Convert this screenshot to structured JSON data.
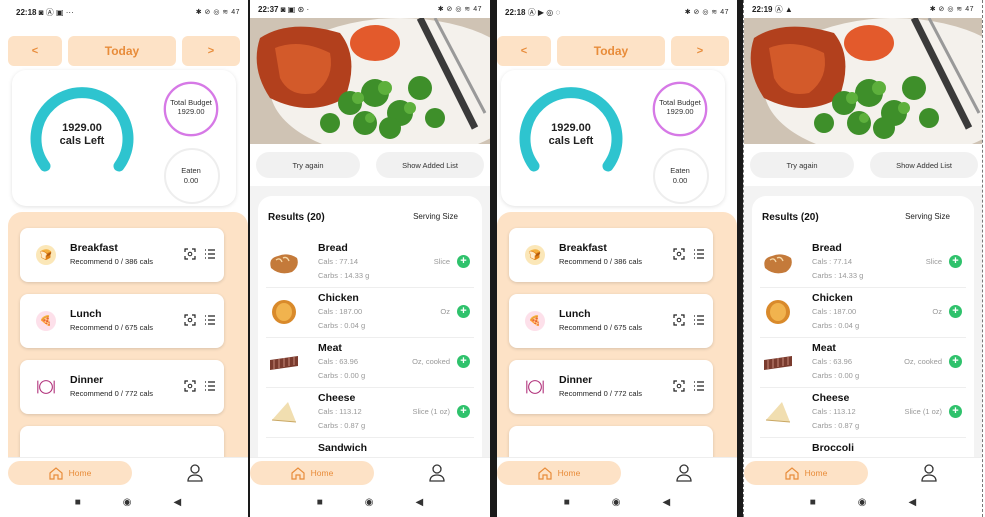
{
  "colors": {
    "accent": "#e88c3a",
    "peach": "#fde2c6",
    "teal": "#2ec4cf",
    "purple": "#d679e6",
    "green": "#2fc26c"
  },
  "home_screens": [
    {
      "status_time": "22:18",
      "status_icons_left": "◙ Ⓐ ▣ ···",
      "status_icons_right": "✱ ⊘ ◎ ≋ 47",
      "nav": {
        "prev": "<",
        "today": "Today",
        "next": ">"
      },
      "calories_left_value": "1929.00",
      "calories_left_label": "cals Left",
      "budget_label": "Total Budget",
      "budget_value": "1929.00",
      "eaten_label": "Eaten",
      "eaten_value": "0.00",
      "meals": [
        {
          "title": "Breakfast",
          "subtitle": "Recommend 0 / 386 cals",
          "icon": "breakfast-icon"
        },
        {
          "title": "Lunch",
          "subtitle": "Recommend 0 / 675 cals",
          "icon": "lunch-icon"
        },
        {
          "title": "Dinner",
          "subtitle": "Recommend 0 / 772 cals",
          "icon": "dinner-icon"
        }
      ],
      "bottom_nav": {
        "home": "Home"
      }
    },
    {
      "status_time": "22:18",
      "status_icons_left": "Ⓐ ▶ ◎ ◌",
      "status_icons_right": "✱ ⊘ ◎ ≋ 47",
      "nav": {
        "prev": "<",
        "today": "Today",
        "next": ">"
      },
      "calories_left_value": "1929.00",
      "calories_left_label": "cals Left",
      "budget_label": "Total Budget",
      "budget_value": "1929.00",
      "eaten_label": "Eaten",
      "eaten_value": "0.00",
      "meals": [
        {
          "title": "Breakfast",
          "subtitle": "Recommend 0 / 386 cals",
          "icon": "breakfast-icon"
        },
        {
          "title": "Lunch",
          "subtitle": "Recommend 0 / 675 cals",
          "icon": "lunch-icon"
        },
        {
          "title": "Dinner",
          "subtitle": "Recommend 0 / 772 cals",
          "icon": "dinner-icon"
        }
      ],
      "bottom_nav": {
        "home": "Home"
      }
    }
  ],
  "results_screens": [
    {
      "status_time": "22:37",
      "status_icons_left": "◙ ▣ ⊛ ·",
      "status_icons_right": "✱ ⊘ ◎ ≋ 47",
      "try_again": "Try again",
      "show_added": "Show Added List",
      "results_title": "Results (20)",
      "serving_size": "Serving Size",
      "foods": [
        {
          "name": "Bread",
          "cals": "Cals : 77.14",
          "carbs": "Carbs : 14.33 g",
          "unit": "Slice"
        },
        {
          "name": "Chicken",
          "cals": "Cals : 187.00",
          "carbs": "Carbs : 0.04 g",
          "unit": "Oz"
        },
        {
          "name": "Meat",
          "cals": "Cals : 63.96",
          "carbs": "Carbs : 0.00 g",
          "unit": "Oz, cooked"
        },
        {
          "name": "Cheese",
          "cals": "Cals : 113.12",
          "carbs": "Carbs : 0.87 g",
          "unit": "Slice (1 oz)"
        },
        {
          "name": "Sandwich",
          "cals": "",
          "carbs": "",
          "unit": ""
        }
      ],
      "bottom_nav": {
        "home": "Home"
      }
    },
    {
      "status_time": "22:19",
      "status_icons_left": "Ⓐ ▲",
      "status_icons_right": "✱ ⊘ ◎ ≋ 47",
      "try_again": "Try again",
      "show_added": "Show Added List",
      "results_title": "Results (20)",
      "serving_size": "Serving Size",
      "foods": [
        {
          "name": "Bread",
          "cals": "Cals : 77.14",
          "carbs": "Carbs : 14.33 g",
          "unit": "Slice"
        },
        {
          "name": "Chicken",
          "cals": "Cals : 187.00",
          "carbs": "Carbs : 0.04 g",
          "unit": "Oz"
        },
        {
          "name": "Meat",
          "cals": "Cals : 63.96",
          "carbs": "Carbs : 0.00 g",
          "unit": "Oz, cooked"
        },
        {
          "name": "Cheese",
          "cals": "Cals : 113.12",
          "carbs": "Carbs : 0.87 g",
          "unit": "Slice (1 oz)"
        },
        {
          "name": "Broccoli",
          "cals": "",
          "carbs": "",
          "unit": ""
        }
      ],
      "bottom_nav": {
        "home": "Home"
      }
    }
  ]
}
